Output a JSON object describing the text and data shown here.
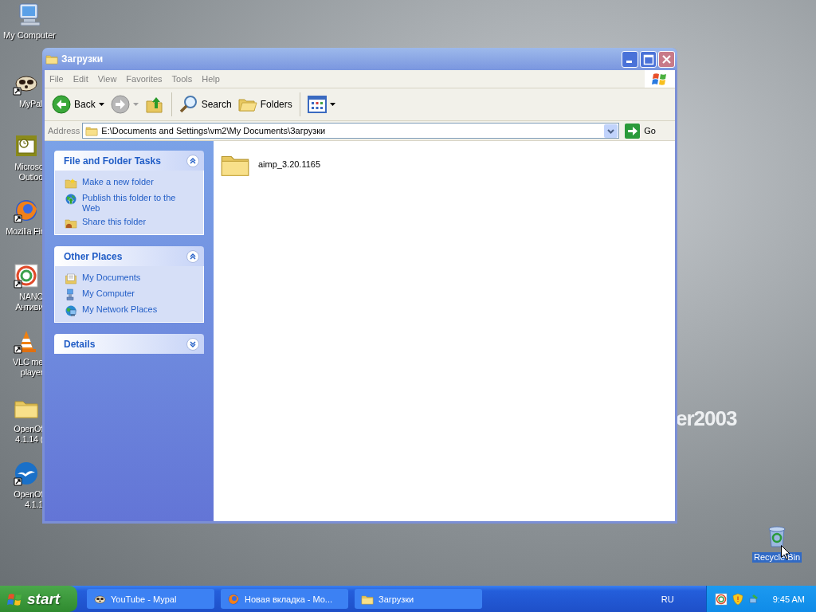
{
  "desktop": {
    "wallpaper_text": "er2003",
    "icons": [
      {
        "kind": "computer",
        "lines": [
          "My Computer"
        ],
        "shortcut": false,
        "selected": false
      },
      {
        "kind": "animal",
        "lines": [
          "MyPal"
        ],
        "shortcut": true,
        "selected": false
      },
      {
        "kind": "mailapp",
        "lines": [
          "Microsc",
          "Outloo"
        ],
        "shortcut": false,
        "selected": false
      },
      {
        "kind": "globe",
        "lines": [
          "Mozilla Fir"
        ],
        "shortcut": true,
        "selected": false
      },
      {
        "kind": "rings",
        "lines": [
          "NANC",
          "Антиви"
        ],
        "shortcut": true,
        "selected": false
      },
      {
        "kind": "cone",
        "lines": [
          "VLC me",
          "player"
        ],
        "shortcut": true,
        "selected": false
      },
      {
        "kind": "folder",
        "lines": [
          "OpenOf",
          "4.1.14 ("
        ],
        "shortcut": false,
        "selected": false
      },
      {
        "kind": "gull",
        "lines": [
          "OpenOf",
          "4.1.1"
        ],
        "shortcut": true,
        "selected": false
      },
      {
        "kind": "trash",
        "lines": [
          "Recycle Bin"
        ],
        "shortcut": false,
        "selected": true
      }
    ]
  },
  "window": {
    "title": "Загрузки",
    "active": false,
    "menu": [
      "File",
      "Edit",
      "View",
      "Favorites",
      "Tools",
      "Help"
    ],
    "toolbar": [
      {
        "kind": "back",
        "label": "Back",
        "disabled": false
      },
      {
        "kind": "forward",
        "disabled": true
      },
      {
        "kind": "up",
        "disabled": false
      },
      {
        "kind": "search",
        "label": "Search",
        "disabled": false
      },
      {
        "kind": "folders",
        "label": "Folders",
        "disabled": false
      },
      {
        "kind": "views",
        "disabled": false
      }
    ],
    "address": {
      "label": "Address",
      "value": "E:\\Documents and Settings\\vm2\\My Documents\\Загрузки",
      "go": "Go"
    },
    "task_sections": [
      {
        "title": "File and Folder Tasks",
        "expanded": true,
        "items": [
          {
            "kind": "newfolder",
            "label": "Make a new folder"
          },
          {
            "kind": "publish",
            "label": "Publish this folder to the Web"
          },
          {
            "kind": "share",
            "label": "Share this folder"
          }
        ]
      },
      {
        "title": "Other Places",
        "expanded": true,
        "items": [
          {
            "kind": "documents",
            "label": "My Documents"
          },
          {
            "kind": "computer",
            "label": "My Computer"
          },
          {
            "kind": "network",
            "label": "My Network Places"
          }
        ]
      },
      {
        "title": "Details",
        "expanded": false
      }
    ],
    "files": [
      {
        "name": "aimp_3.20.1165",
        "kind": "folder"
      }
    ]
  },
  "taskbar": {
    "start": "start",
    "tasks": [
      {
        "kind": "animal",
        "label": "YouTube - Mypal",
        "selected": false
      },
      {
        "kind": "globe",
        "label": "Новая вкладка - Mo...",
        "selected": false
      },
      {
        "kind": "folder",
        "label": "Загрузки",
        "selected": false
      }
    ],
    "language": "RU",
    "clock": "9:45 AM"
  }
}
